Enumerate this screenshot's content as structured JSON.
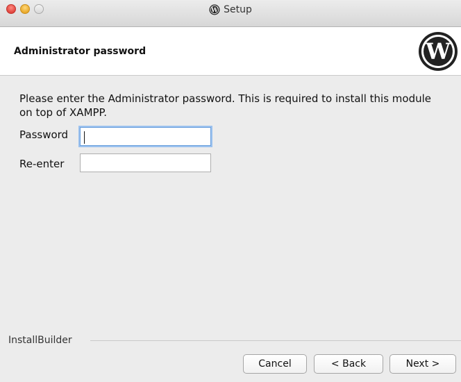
{
  "window": {
    "title": "Setup",
    "title_icon": "wordpress-icon"
  },
  "header": {
    "title": "Administrator password",
    "logo_icon": "wordpress-logo-icon"
  },
  "body": {
    "description": "Please enter the Administrator password. This is required to install this module on top of XAMPP.",
    "password_label": "Password",
    "password_value": "",
    "reenter_label": "Re-enter",
    "reenter_value": ""
  },
  "footer": {
    "group_label": "InstallBuilder",
    "cancel_label": "Cancel",
    "back_label": "< Back",
    "next_label": "Next >"
  }
}
